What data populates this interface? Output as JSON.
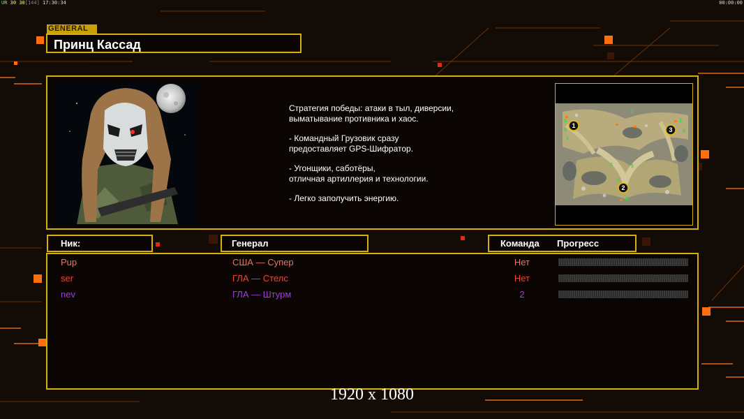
{
  "hud": {
    "fps_a": "UR",
    "fps_b": "30",
    "fps_c": "30",
    "fps_d": "[144]",
    "clock": "17:30:34",
    "timer": "00:00:00"
  },
  "header": {
    "tag": "GENERAL",
    "general_name": "Принц Кассад"
  },
  "info": {
    "strategy_lines": [
      "Стратегия победы: атаки в тыл, диверсии,\n выматывание противника и хаос.",
      "- Командный Грузовик сразу\nпредоставляет GPS-Шифратор.",
      "- Угонщики, саботёры,\nотличная артиллерия и технологии.",
      "- Легко заполучить энергию."
    ],
    "map_slots": [
      "1",
      "2",
      "3"
    ]
  },
  "columns": {
    "nick": "Ник:",
    "general": "Генерал",
    "team": "Команда",
    "progress": "Прогресс"
  },
  "players": [
    {
      "nick": "Pup",
      "general": "США — Супер",
      "team": "Нет",
      "progress": 0,
      "color": "#e0776d"
    },
    {
      "nick": "ser",
      "general": "ГЛА — Стелс",
      "team": "Нет",
      "progress": 0,
      "color": "#e8473a"
    },
    {
      "nick": "nev",
      "general": "ГЛА — Штурм",
      "team": "2",
      "progress": 0,
      "color": "#a23ce0"
    }
  ],
  "footer": {
    "resolution": "1920 x 1080"
  },
  "colors": {
    "accent": "#d6b10c",
    "background": "#120b06",
    "hud_orange": "#ff8a1a"
  }
}
